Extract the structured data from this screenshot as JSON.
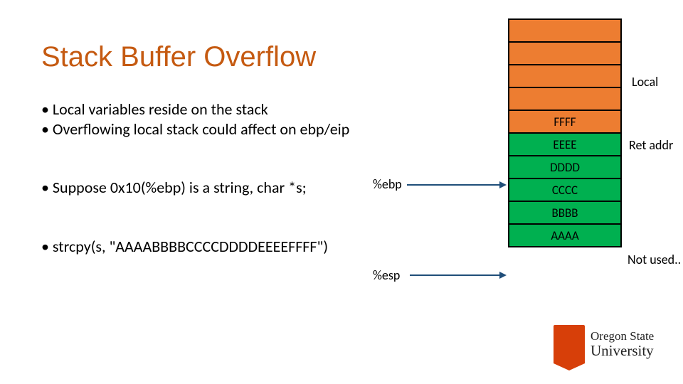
{
  "title": "Stack Buffer Overflow",
  "bullets": {
    "b1": "• Local variables reside on the stack",
    "b2": "• Overflowing local stack could affect on ebp/eip",
    "b3": "• Suppose 0x10(%ebp) is a string, char *s;",
    "b4": "• strcpy(s, \"AAAABBBBCCCCDDDDEEEEFFFF\")"
  },
  "pointers": {
    "ebp": "%ebp",
    "esp": "%esp"
  },
  "annotations": {
    "local": "Local",
    "retaddr": "Ret addr",
    "notused": "Not used.."
  },
  "stack": {
    "c0": "",
    "c1": "",
    "c2": "",
    "c3": "",
    "c4": "FFFF",
    "c5": "EEEE",
    "c6": "DDDD",
    "c7": "CCCC",
    "c8": "BBBB",
    "c9": "AAAA"
  },
  "logo": {
    "line1": "Oregon State",
    "line2": "University"
  }
}
